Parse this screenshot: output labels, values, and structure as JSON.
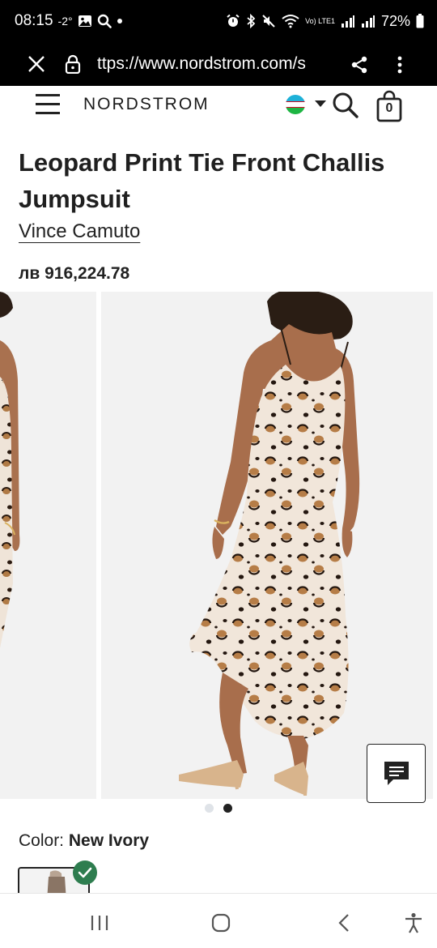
{
  "status_bar": {
    "time": "08:15",
    "temperature": "-2°",
    "battery": "72%",
    "network_label": "Vo) LTE1"
  },
  "browser": {
    "url": "ttps://www.nordstrom.com/s"
  },
  "site": {
    "logo": "NORDSTROM",
    "bag_count": "0"
  },
  "product": {
    "title": "Leopard Print Tie Front Challis Jumpsuit",
    "brand": "Vince Camuto",
    "price": "лв 916,224.78",
    "color_label": "Color:",
    "color_value": "New Ivory"
  },
  "gallery": {
    "slide_count": 2,
    "active_slide": 2
  },
  "colors": {
    "accent_check": "#2e7d4f",
    "chrome": "#000000"
  }
}
